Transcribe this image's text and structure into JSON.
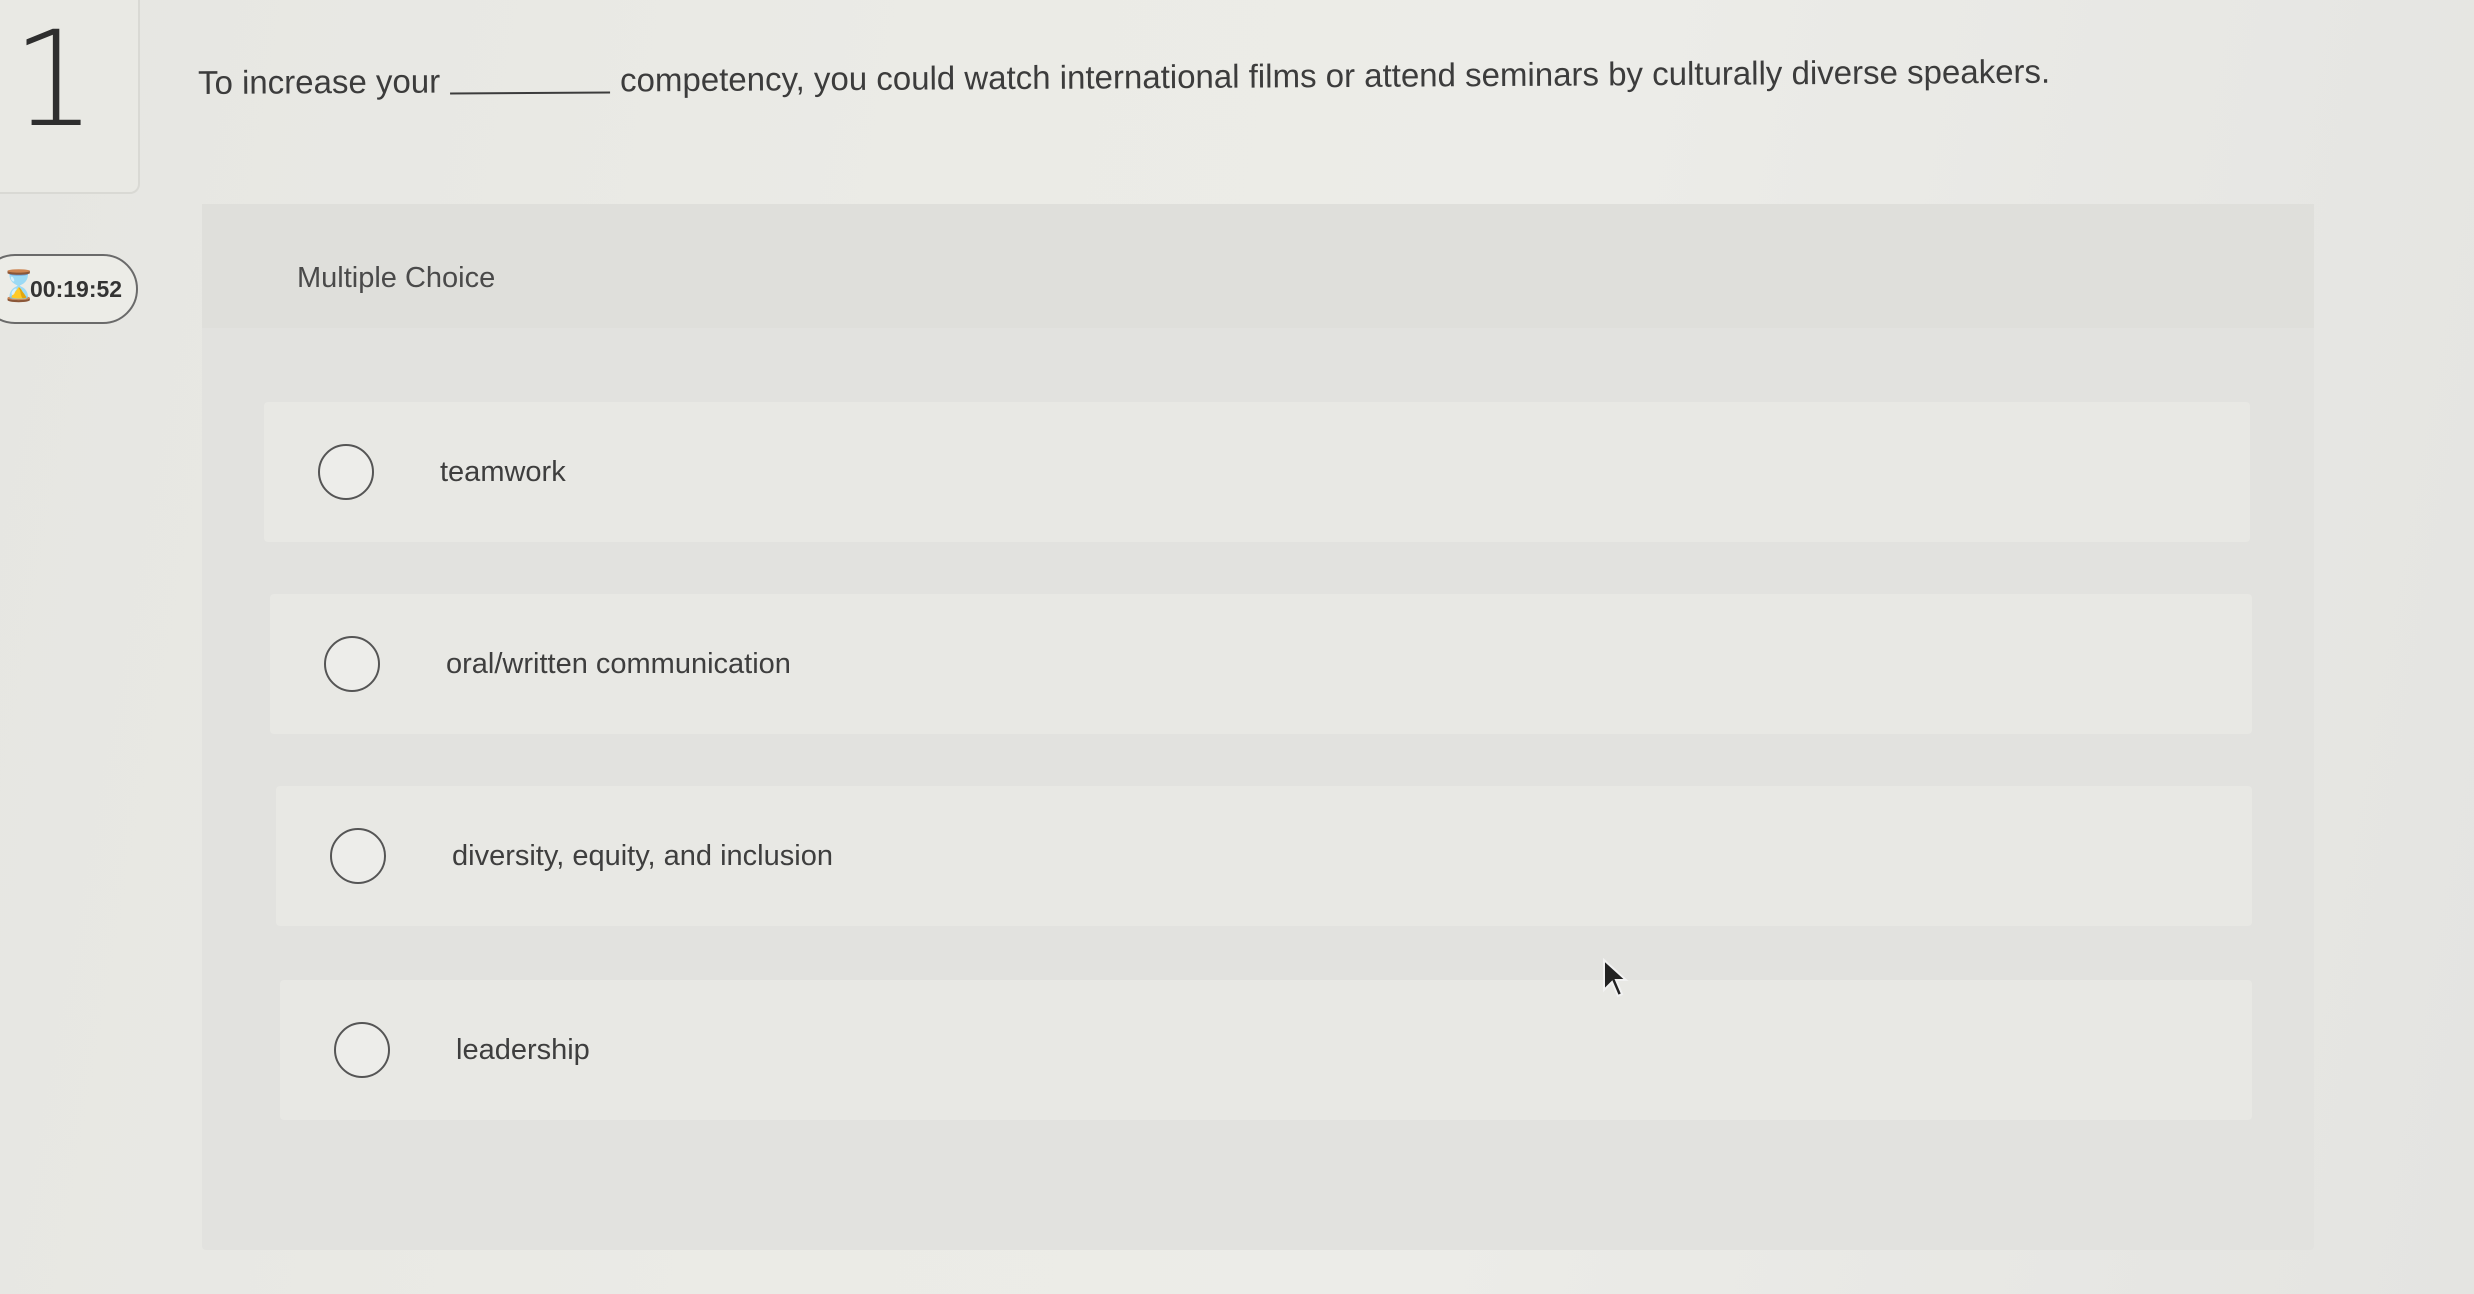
{
  "question": {
    "number": "1",
    "text_before": "To increase your",
    "text_after": "competency, you could watch international films or attend seminars by culturally diverse speakers."
  },
  "timer": {
    "icon": "hourglass-icon",
    "value": "00:19:52"
  },
  "panel": {
    "type_label": "Multiple Choice"
  },
  "options": [
    {
      "label": "teamwork",
      "selected": false
    },
    {
      "label": "oral/written communication",
      "selected": false
    },
    {
      "label": "diversity, equity, and inclusion",
      "selected": false
    },
    {
      "label": "leadership",
      "selected": false
    }
  ]
}
